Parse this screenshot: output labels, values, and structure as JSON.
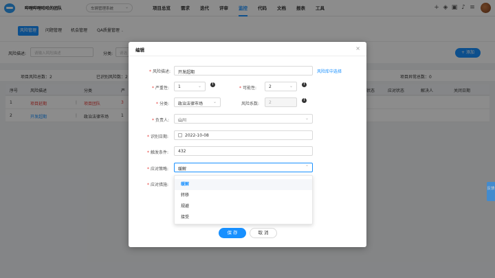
{
  "topnav": {
    "team_name": "哔哩哔哩哈哈的团队",
    "project": "车辆管理系统",
    "menu": [
      "项目总览",
      "需求",
      "迭代",
      "评审",
      "监控",
      "代码",
      "文档",
      "报表",
      "工具"
    ],
    "active_menu": "监控",
    "icons": [
      "plus-icon",
      "layers-icon",
      "bag-icon",
      "bell-icon",
      "settings-sliders-icon"
    ]
  },
  "subtabs": {
    "items": [
      "风险管理",
      "问题管理",
      "机会管理",
      "QA质量管理"
    ],
    "active": "风险管理"
  },
  "filter": {
    "desc_label": "风险描述:",
    "desc_placeholder": "请输入风险描述",
    "category_label": "分类:",
    "category_placeholder": "请选",
    "add_label": "+ 添加"
  },
  "stats": {
    "total": "项目风险总数：2",
    "identified": "已识别风险数：2",
    "abnormal": "项目异常总数：0"
  },
  "table": {
    "headers": [
      "序号",
      "风险描述",
      "分类",
      "严",
      "",
      "状态",
      "应对状态",
      "解决人",
      "关闭日期"
    ],
    "rows": [
      {
        "idx": "1",
        "desc": "项目延期",
        "category": "项目团队",
        "severity": "3",
        "color": "red"
      },
      {
        "idx": "2",
        "desc": "开发超期",
        "category": "政治法律市场",
        "severity": "1",
        "color": "blue"
      }
    ]
  },
  "side_tab": "反馈",
  "modal": {
    "title": "编辑",
    "fields": {
      "desc_label": "风险描述:",
      "desc_value": "开发超期",
      "risk_lib_link": "风险库中选择",
      "severity_label": "严重性:",
      "severity_value": "1",
      "possibility_label": "可能性:",
      "possibility_value": "2",
      "category_label": "分类:",
      "category_value": "政治法律市场",
      "factor_label": "风险系数:",
      "factor_value": "2",
      "owner_label": "负责人:",
      "owner_value": "山川",
      "identify_date_label": "识别日期:",
      "identify_date_value": "2022-10-08",
      "trigger_label": "触发条件:",
      "trigger_value": "432",
      "strategy_label": "应对策略:",
      "strategy_value": "缓解",
      "measure_label": "应对措施:"
    },
    "strategy_options": [
      "缓解",
      "转移",
      "规避",
      "接受"
    ],
    "selected_option": "缓解",
    "save_label": "保 存",
    "cancel_label": "取 消"
  }
}
